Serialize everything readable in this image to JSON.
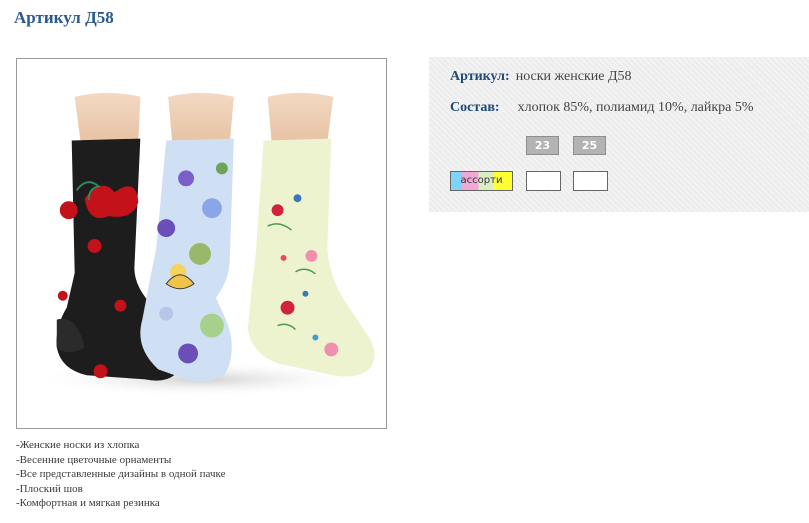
{
  "page": {
    "title": "Артикул Д58"
  },
  "product_image": {
    "alt": "Три пары женских носков с цветочным рисунком"
  },
  "info": {
    "article_label": "Артикул:",
    "article_value": "носки женские Д58",
    "composition_label": "Состав:",
    "composition_value": "хлопок 85%, полиамид 10%, лайкра 5%"
  },
  "sizes": [
    "23",
    "25"
  ],
  "colors": [
    {
      "label": "ассорти",
      "swatch": [
        "#7fd3ff",
        "#f0a8d6",
        "#d9eec2",
        "#ffff33"
      ]
    },
    {
      "label": ""
    },
    {
      "label": ""
    }
  ],
  "features": [
    "-Женские носки из хлопка",
    "-Весенние цветочные орнаменты",
    "-Все представленные дизайны в одной пачке",
    "-Плоский шов",
    "-Комфортная и мягкая резинка"
  ],
  "palette": {
    "title": "#2a5a8c",
    "label": "#1f4a78",
    "panel_bg": "#ededed",
    "chip_bg": "#b3b3b3"
  }
}
